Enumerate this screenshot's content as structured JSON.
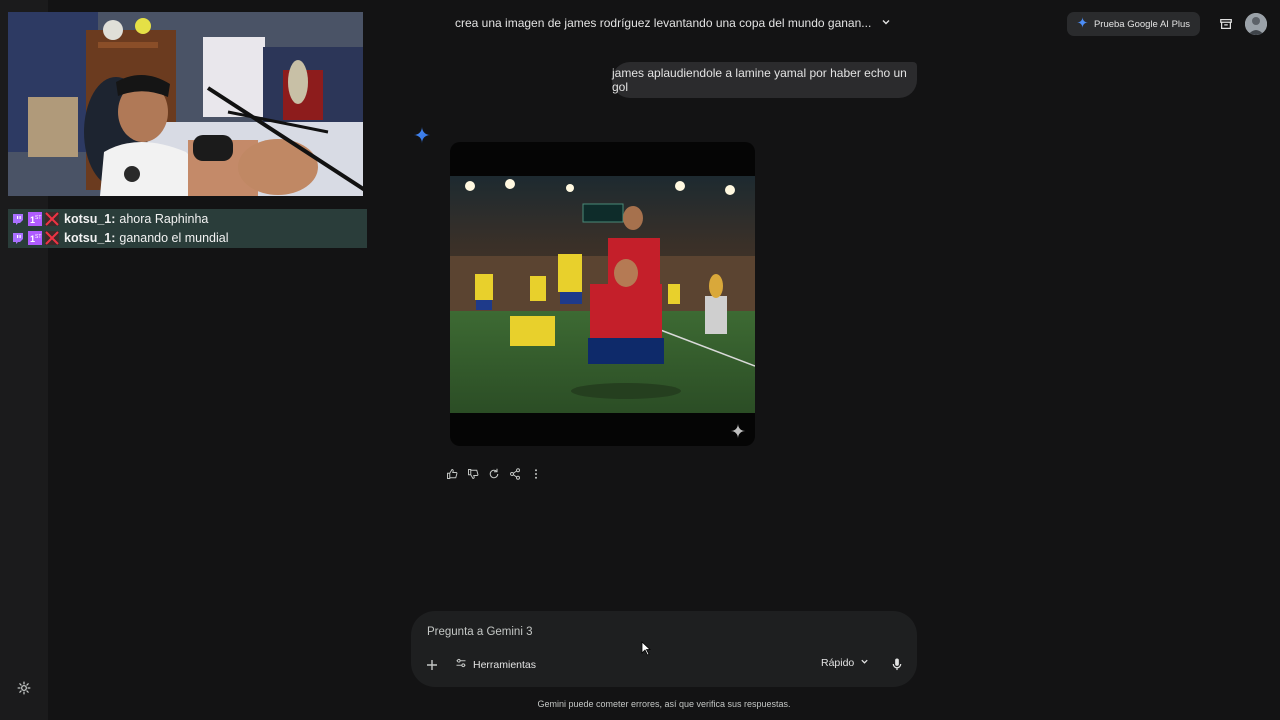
{
  "conversation": {
    "title": "crea una imagen de james rodríguez levantando una copa del mundo ganan..."
  },
  "header": {
    "ai_plus_label": "Prueba Google AI Plus"
  },
  "stream_chat": [
    {
      "user": "kotsu_1:",
      "message": "ahora Raphinha"
    },
    {
      "user": "kotsu_1:",
      "message": "ganando el mundial"
    }
  ],
  "user_message": "james aplaudiendole a lamine yamal por haber echo un gol",
  "composer": {
    "placeholder": "Pregunta a Gemini 3",
    "tools_label": "Herramientas",
    "mode_label": "Rápido"
  },
  "footer": {
    "disclaimer": "Gemini puede cometer errores, así que verifica sus respuestas."
  },
  "icons": {
    "sidebar": "settings-icon",
    "actions": [
      "thumbs-up-icon",
      "thumbs-down-icon",
      "regenerate-icon",
      "share-icon",
      "more-vert-icon"
    ]
  },
  "colors": {
    "background": "#131314",
    "accent": "#4c8df6",
    "bubble": "#2b2b2d"
  }
}
